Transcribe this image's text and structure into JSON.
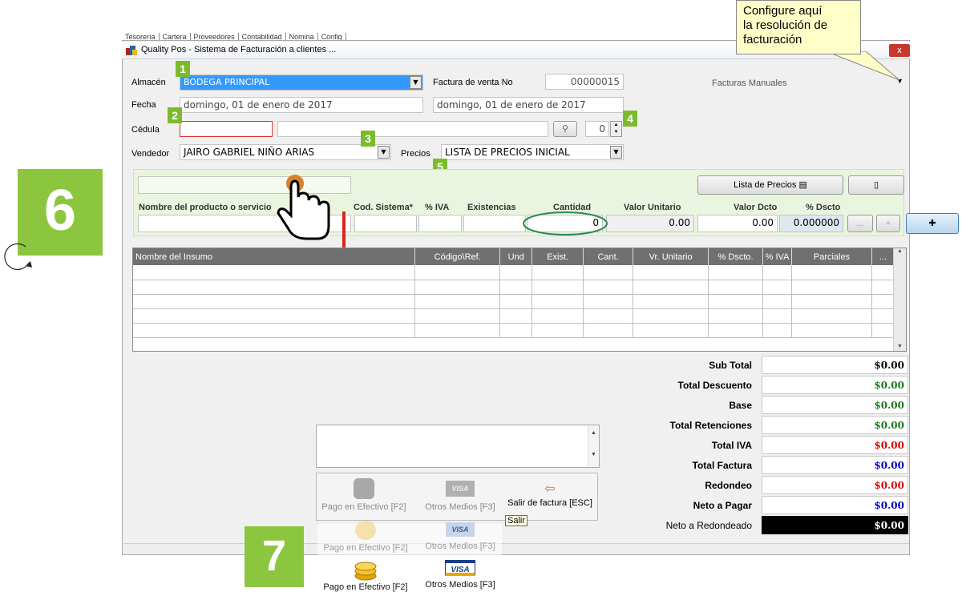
{
  "window": {
    "title": "Quality Pos - Sistema de Facturación a clientes ...",
    "close": "x",
    "menu_tabs": [
      "Tesorería",
      "Cartera",
      "Proveedores",
      "Contabilidad",
      "Nomina",
      "Config"
    ]
  },
  "tooltip": {
    "line1": "Configure aquí",
    "line2": "la resolución de",
    "line3": "facturación"
  },
  "header": {
    "almacen_label": "Almacén",
    "almacen_value": "BODEGA PRINCIPAL",
    "factura_label": "Factura de venta No",
    "factura_value": "00000015",
    "facturas_manuales": "Facturas Manuales",
    "fecha_label": "Fecha",
    "fecha_value": "domingo, 01 de enero de 2017",
    "fecha_value2": "domingo, 01 de enero de 2017",
    "cedula_label": "Cédula",
    "cedula_value": "",
    "cedula_name": "",
    "spin_value": "0",
    "vendedor_label": "Vendedor",
    "vendedor_value": "JAIRO GABRIEL NIÑO ARIAS",
    "precios_label": "Precios",
    "precios_value": "LISTA DE PRECIOS INICIAL"
  },
  "badges": {
    "b1": "1",
    "b2": "2",
    "b3": "3",
    "b4": "4",
    "b5": "5",
    "b6": "6",
    "b7": "7"
  },
  "entry": {
    "lista_precios": "Lista de Precios",
    "col_nombre": "Nombre del producto o servicio",
    "col_cod": "Cod. Sistema*",
    "col_iva": "% IVA",
    "col_exist": "Existencias",
    "col_cant": "Cantidad",
    "col_valor": "Valor Unitario",
    "col_dcto": "Valor Dcto",
    "col_pdcto": "% Dscto",
    "cant_value": "0",
    "valor_value": "0.00",
    "dcto_value": "0.00",
    "pdcto_value": "0.000000",
    "more": "...",
    "plus": "+",
    "hand_plus": "✚"
  },
  "grid": {
    "columns": [
      "Nombre del Insumo",
      "Código\\Ref.",
      "Und",
      "Exist.",
      "Cant.",
      "Vr. Unitario",
      "% Dscto.",
      "% IVA",
      "Parciales",
      "..."
    ],
    "row_count": 5
  },
  "totals": [
    {
      "label": "Sub Total",
      "value": "$0.00",
      "color": "#000000"
    },
    {
      "label": "Total Descuento",
      "value": "$0.00",
      "color": "#1a7a1a"
    },
    {
      "label": "Base",
      "value": "$0.00",
      "color": "#1a7a1a"
    },
    {
      "label": "Total Retenciones",
      "value": "$0.00",
      "color": "#1a7a1a"
    },
    {
      "label": "Total IVA",
      "value": "$0.00",
      "color": "#e00000"
    },
    {
      "label": "Total Factura",
      "value": "$0.00",
      "color": "#0000cc"
    },
    {
      "label": "Redondeo",
      "value": "$0.00",
      "color": "#e00000"
    },
    {
      "label": "Neto a Pagar",
      "value": "$0.00",
      "color": "#0000cc"
    },
    {
      "label": "Neto a Redondeado",
      "value": "$0.00",
      "color": "#ffffff"
    }
  ],
  "payment": {
    "efectivo": "Pago en Efectivo [F2]",
    "otros": "Otros Medios [F3]",
    "salir": "Salir de factura [ESC]",
    "salir_tip": "Salir",
    "visa": "VISA"
  }
}
